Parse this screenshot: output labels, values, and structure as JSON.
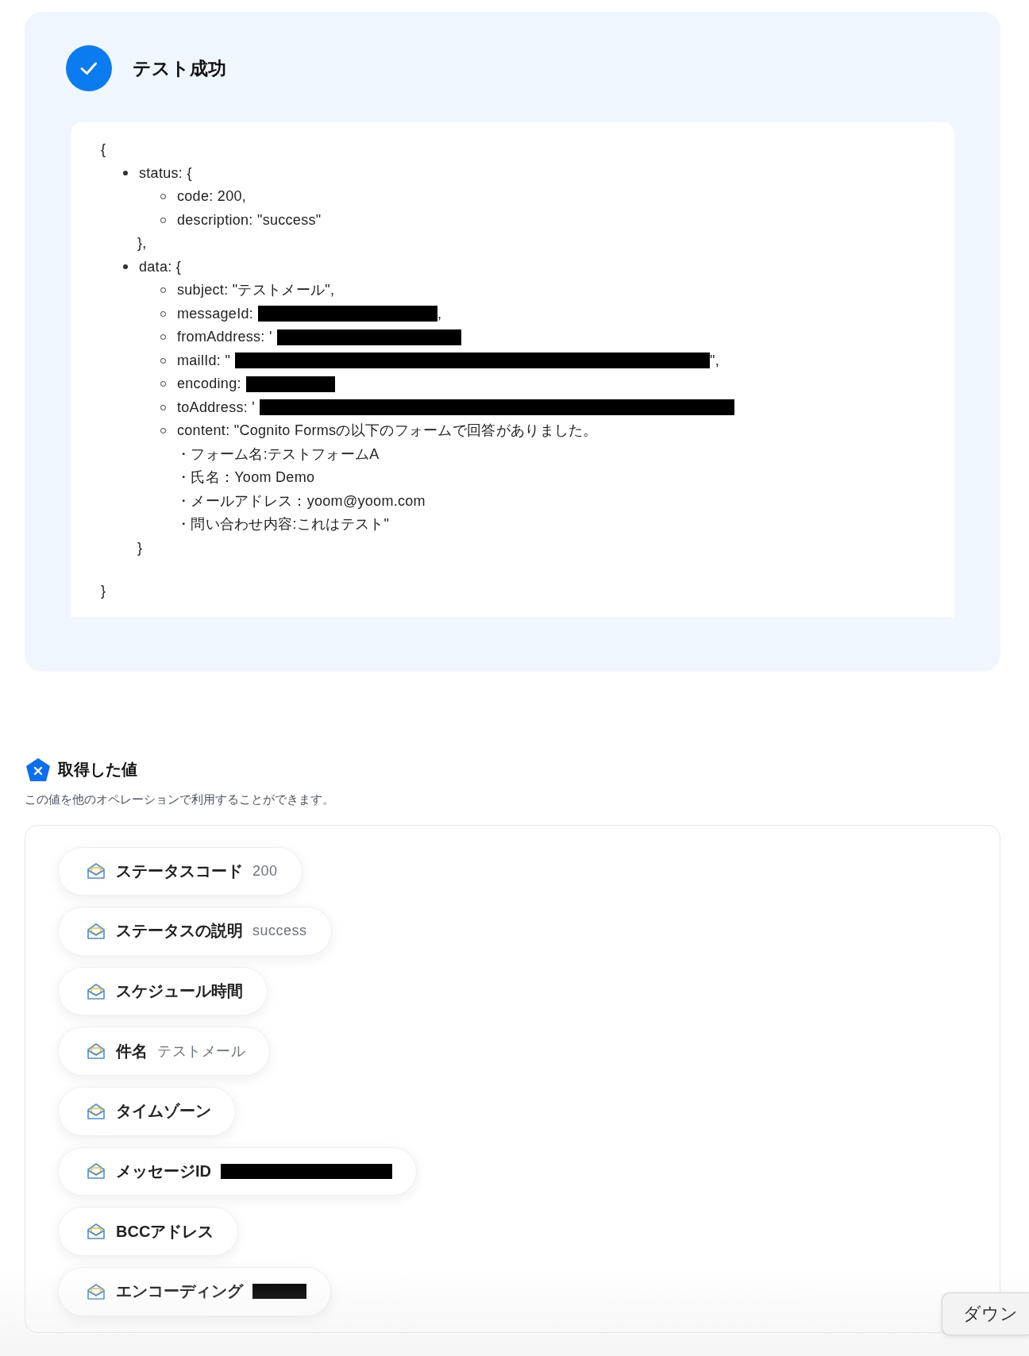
{
  "result": {
    "title": "テスト成功",
    "passed": true,
    "output": {
      "open": "{",
      "close": "}",
      "items": [
        {
          "key": "status: {",
          "close": "},",
          "children": [
            {
              "text": "code: 200,"
            },
            {
              "text": "description: \"success\""
            }
          ]
        },
        {
          "key": "data: {",
          "close": "}",
          "children": [
            {
              "text": "subject: \"テストメール\","
            },
            {
              "text": "messageId:",
              "redacted": true,
              "after": ","
            },
            {
              "text": "fromAddress: '",
              "redacted": true
            },
            {
              "text": "mailId: \"",
              "redacted": true,
              "after": "\","
            },
            {
              "text": "encoding:",
              "redacted": true
            },
            {
              "text": "toAddress: '",
              "redacted": true
            },
            {
              "text": "content: \"Cognito Formsの以下のフォームで回答がありました。",
              "more": [
                "・フォーム名:テストフォームA",
                "・氏名：Yoom Demo",
                "・メールアドレス：yoom@yoom.com",
                "・問い合わせ内容:これはテスト\""
              ]
            }
          ]
        }
      ]
    }
  },
  "values": {
    "title": "取得した値",
    "description": "この値を他のオペレーションで利用することができます。",
    "chips": [
      {
        "label": "ステータスコード",
        "value": "200"
      },
      {
        "label": "ステータスの説明",
        "value": "success"
      },
      {
        "label": "スケジュール時間"
      },
      {
        "label": "件名",
        "value": "テストメール"
      },
      {
        "label": "タイムゾーン"
      },
      {
        "label": "メッセージID",
        "redacted": true
      },
      {
        "label": "BCCアドレス"
      },
      {
        "label": "エンコーディング",
        "redacted": true
      }
    ]
  },
  "floating_button": {
    "label": "ダウン"
  }
}
